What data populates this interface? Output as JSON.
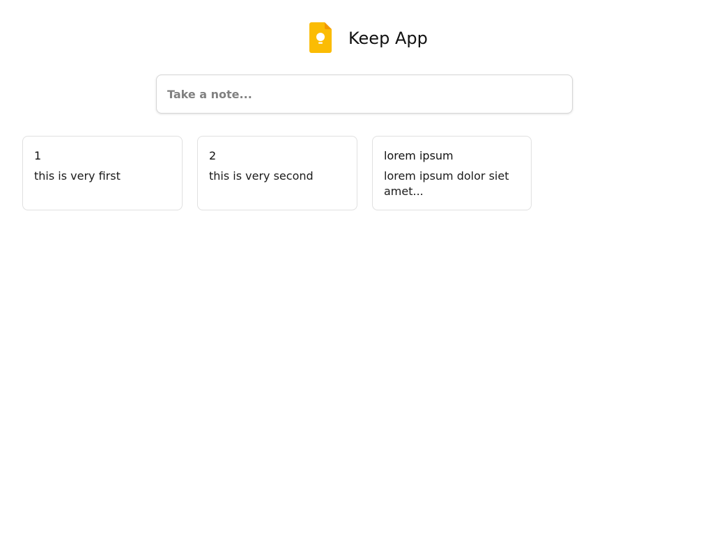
{
  "header": {
    "title": "Keep App",
    "logo_icon": "keep-note-icon",
    "brand_color": "#fbbc04"
  },
  "composer": {
    "placeholder": "Take a note...",
    "value": ""
  },
  "notes": [
    {
      "title": "1",
      "content": "this is very first"
    },
    {
      "title": "2",
      "content": "this is very second"
    },
    {
      "title": "lorem ipsum",
      "content": "lorem ipsum dolor siet amet..."
    }
  ]
}
